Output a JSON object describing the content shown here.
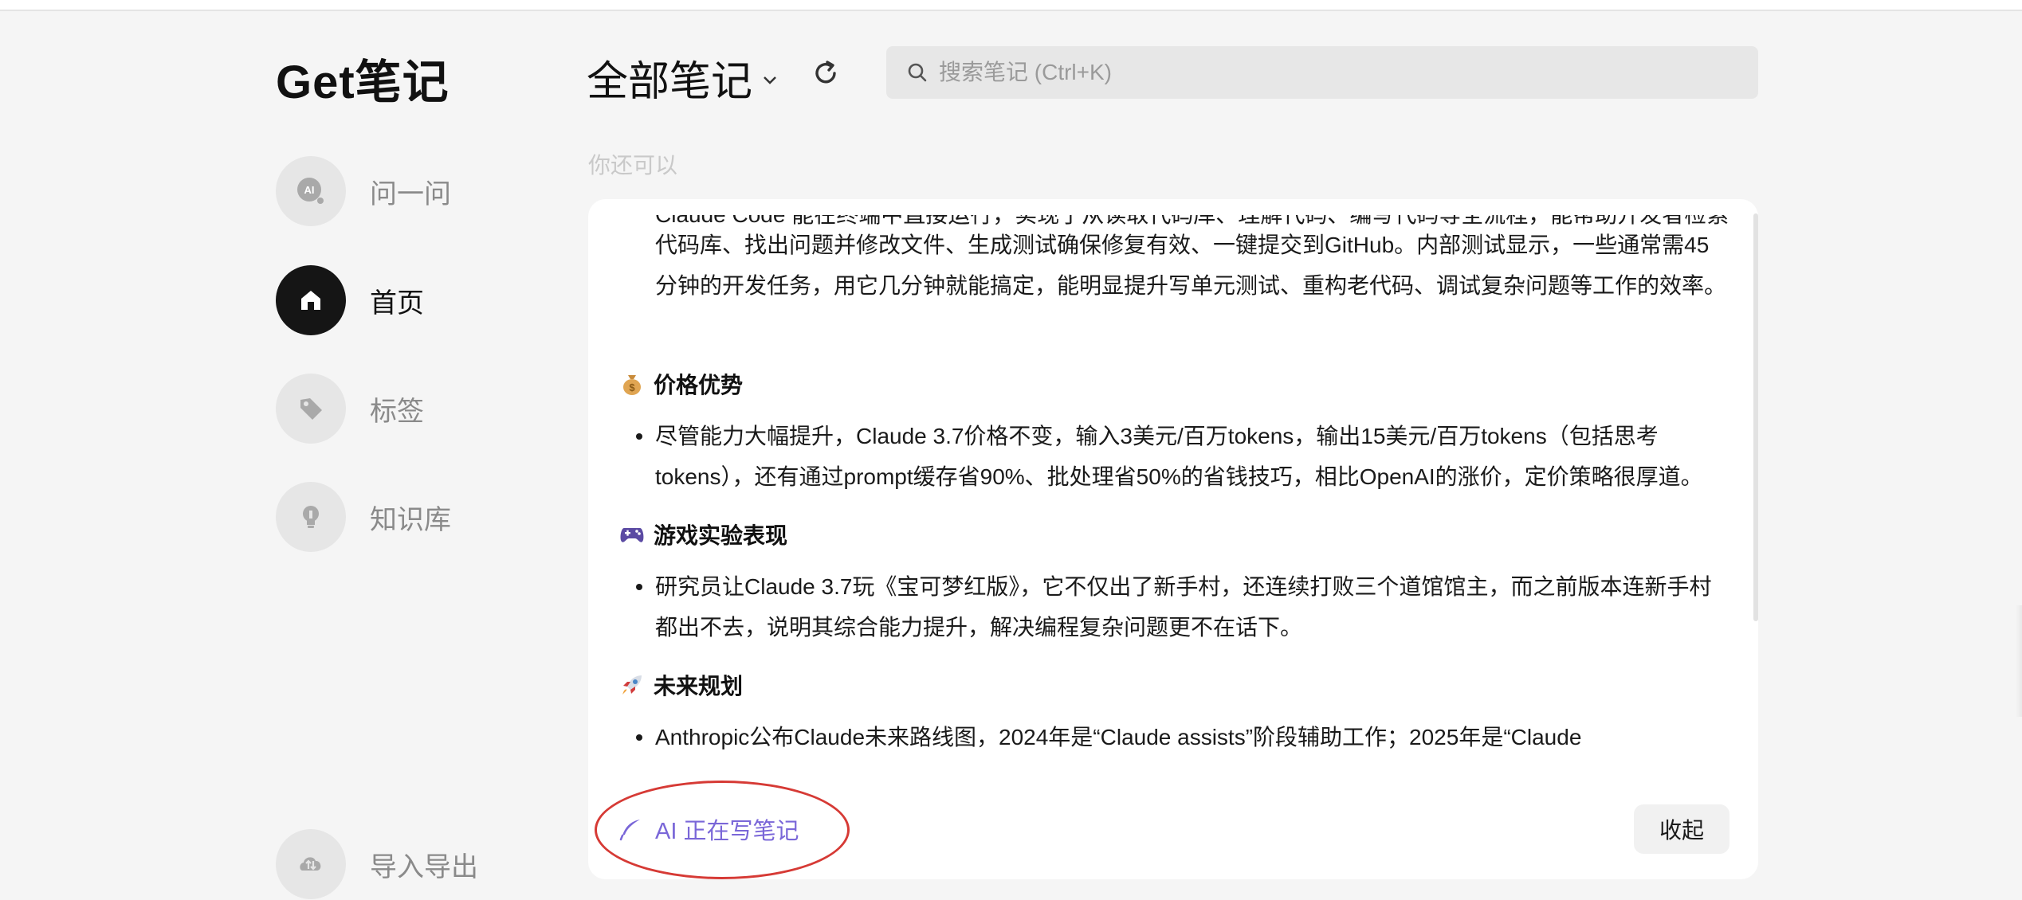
{
  "app": {
    "logo": "Get笔记"
  },
  "sidebar": {
    "items": [
      {
        "label": "问一问",
        "icon": "ai-chat-icon",
        "active": false
      },
      {
        "label": "首页",
        "icon": "home-icon",
        "active": true
      },
      {
        "label": "标签",
        "icon": "tag-icon",
        "active": false
      },
      {
        "label": "知识库",
        "icon": "lightbulb-icon",
        "active": false
      }
    ],
    "bottom_item": {
      "label": "导入导出",
      "icon": "import-export-icon"
    }
  },
  "header": {
    "view_title": "全部笔记",
    "search_placeholder": "搜索笔记 (Ctrl+K)"
  },
  "hint_text": "你还可以",
  "note": {
    "cut_line": "Claude Code 能在终端中直接运行，实现了从读取代码库、理解代码、编写代码等全流程，能帮助开发者检索",
    "para_1": "代码库、找出问题并修改文件、生成测试确保修复有效、一键提交到GitHub。内部测试显示，一些通常需45分钟的开发任务，用它几分钟就能搞定，能明显提升写单元测试、重构老代码、调试复杂问题等工作的效率。",
    "sections": [
      {
        "emoji": "money-bag-icon",
        "heading": "价格优势",
        "bullet": "尽管能力大幅提升，Claude 3.7价格不变，输入3美元/百万tokens，输出15美元/百万tokens（包括思考tokens），还有通过prompt缓存省90%、批处理省50%的省钱技巧，相比OpenAI的涨价，定价策略很厚道。"
      },
      {
        "emoji": "game-controller-icon",
        "heading": "游戏实验表现",
        "bullet": "研究员让Claude 3.7玩《宝可梦红版》，它不仅出了新手村，还连续打败三个道馆馆主，而之前版本连新手村都出不去，说明其综合能力提升，解决编程复杂问题更不在话下。"
      },
      {
        "emoji": "rocket-icon",
        "heading": "未来规划",
        "bullet": "Anthropic公布Claude未来路线图，2024年是“Claude assists”阶段辅助工作；2025年是“Claude"
      }
    ],
    "ai_status": "AI 正在写笔记",
    "collapse_label": "收起"
  },
  "colors": {
    "accent_purple": "#7a67d8",
    "annotation_red": "#d63a35",
    "active_nav": "#151515"
  }
}
